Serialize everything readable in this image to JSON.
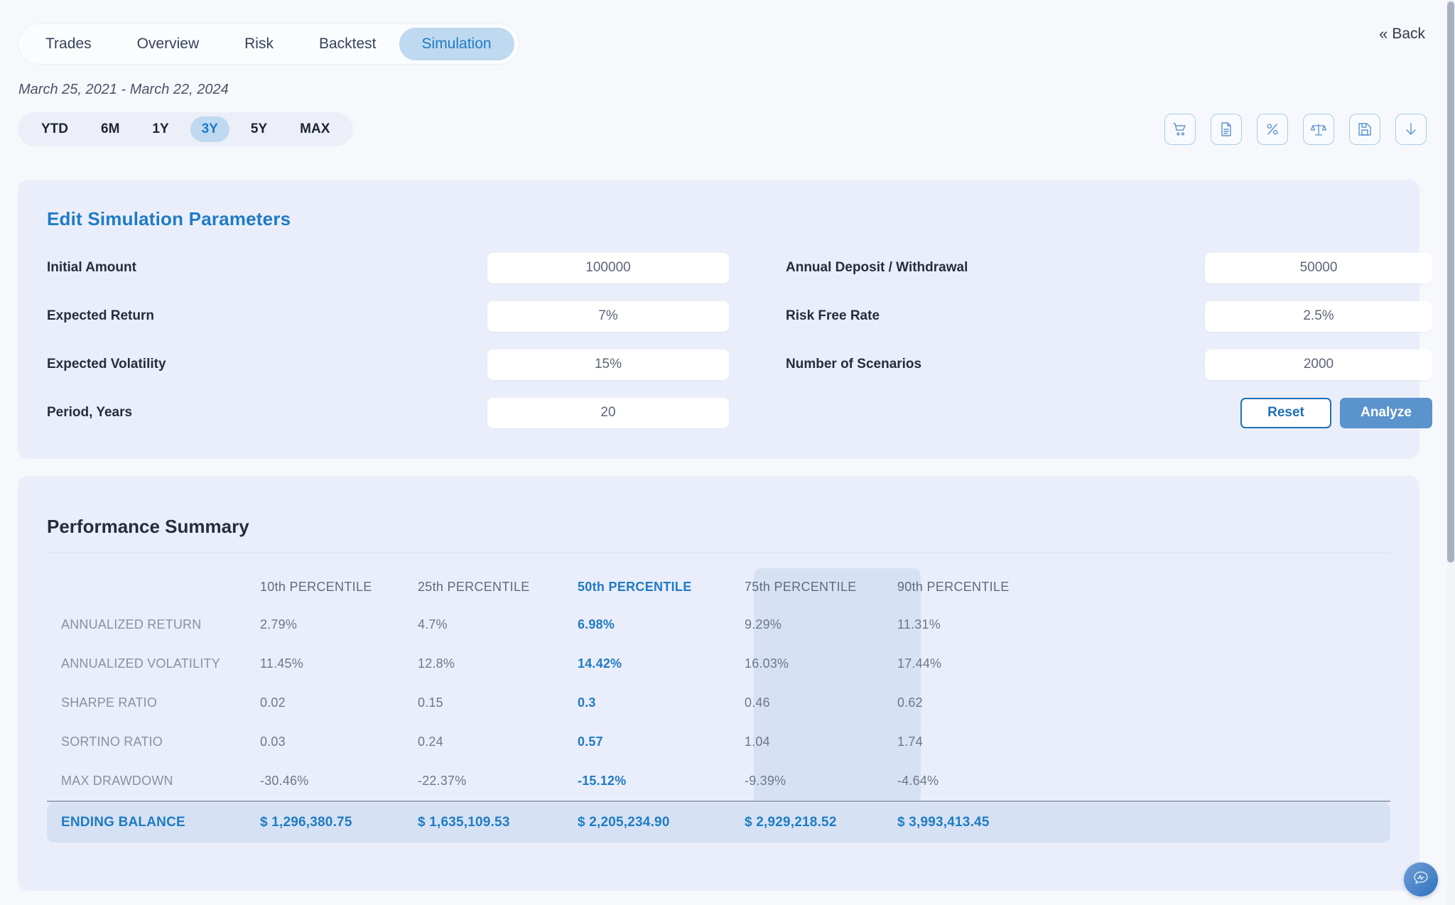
{
  "nav": {
    "tabs": [
      {
        "label": "Trades",
        "active": false
      },
      {
        "label": "Overview",
        "active": false
      },
      {
        "label": "Risk",
        "active": false
      },
      {
        "label": "Backtest",
        "active": false
      },
      {
        "label": "Simulation",
        "active": true
      }
    ],
    "back_label": "Back",
    "back_chevron": "«"
  },
  "date_range_text": "March 25, 2021 - March 22, 2024",
  "time_ranges": [
    {
      "label": "YTD",
      "active": false
    },
    {
      "label": "6M",
      "active": false
    },
    {
      "label": "1Y",
      "active": false
    },
    {
      "label": "3Y",
      "active": true
    },
    {
      "label": "5Y",
      "active": false
    },
    {
      "label": "MAX",
      "active": false
    }
  ],
  "toolbar_icons": [
    {
      "name": "shopping-cart-icon"
    },
    {
      "name": "document-icon"
    },
    {
      "name": "percent-icon"
    },
    {
      "name": "balance-scale-icon"
    },
    {
      "name": "save-icon"
    },
    {
      "name": "download-icon"
    }
  ],
  "params": {
    "title": "Edit Simulation Parameters",
    "fields_left": [
      {
        "label": "Initial Amount",
        "value": "100000"
      },
      {
        "label": "Expected Return",
        "value": "7%"
      },
      {
        "label": "Expected Volatility",
        "value": "15%"
      },
      {
        "label": "Period, Years",
        "value": "20"
      }
    ],
    "fields_right": [
      {
        "label": "Annual Deposit / Withdrawal",
        "value": "50000"
      },
      {
        "label": "Risk Free Rate",
        "value": "2.5%"
      },
      {
        "label": "Number of Scenarios",
        "value": "2000"
      }
    ],
    "reset_label": "Reset",
    "analyze_label": "Analyze"
  },
  "summary": {
    "title": "Performance Summary",
    "highlight_column_index": 3,
    "columns": [
      "",
      "10th PERCENTILE",
      "25th PERCENTILE",
      "50th PERCENTILE",
      "75th PERCENTILE",
      "90th PERCENTILE"
    ],
    "rows": [
      {
        "label": "ANNUALIZED RETURN",
        "values": [
          "2.79%",
          "4.7%",
          "6.98%",
          "9.29%",
          "11.31%"
        ]
      },
      {
        "label": "ANNUALIZED VOLATILITY",
        "values": [
          "11.45%",
          "12.8%",
          "14.42%",
          "16.03%",
          "17.44%"
        ]
      },
      {
        "label": "SHARPE RATIO",
        "values": [
          "0.02",
          "0.15",
          "0.3",
          "0.46",
          "0.62"
        ]
      },
      {
        "label": "SORTINO RATIO",
        "values": [
          "0.03",
          "0.24",
          "0.57",
          "1.04",
          "1.74"
        ]
      },
      {
        "label": "MAX DRAWDOWN",
        "values": [
          "-30.46%",
          "-22.37%",
          "-15.12%",
          "-9.39%",
          "-4.64%"
        ]
      }
    ],
    "total_row": {
      "label": "ENDING BALANCE",
      "values": [
        "$ 1,296,380.75",
        "$ 1,635,109.53",
        "$ 2,205,234.90",
        "$ 2,929,218.52",
        "$ 3,993,413.45"
      ]
    }
  },
  "chat_fab": {
    "name": "chat-assistant-icon"
  },
  "colors": {
    "page_bg": "#f6f8fb",
    "card_bg": "#eaeefa",
    "accent_blue": "#1f7bc4",
    "pill_active_bg": "#bed9f0",
    "highlight_col_bg": "#d6e2f3",
    "analyze_bg": "#5b93cc"
  }
}
